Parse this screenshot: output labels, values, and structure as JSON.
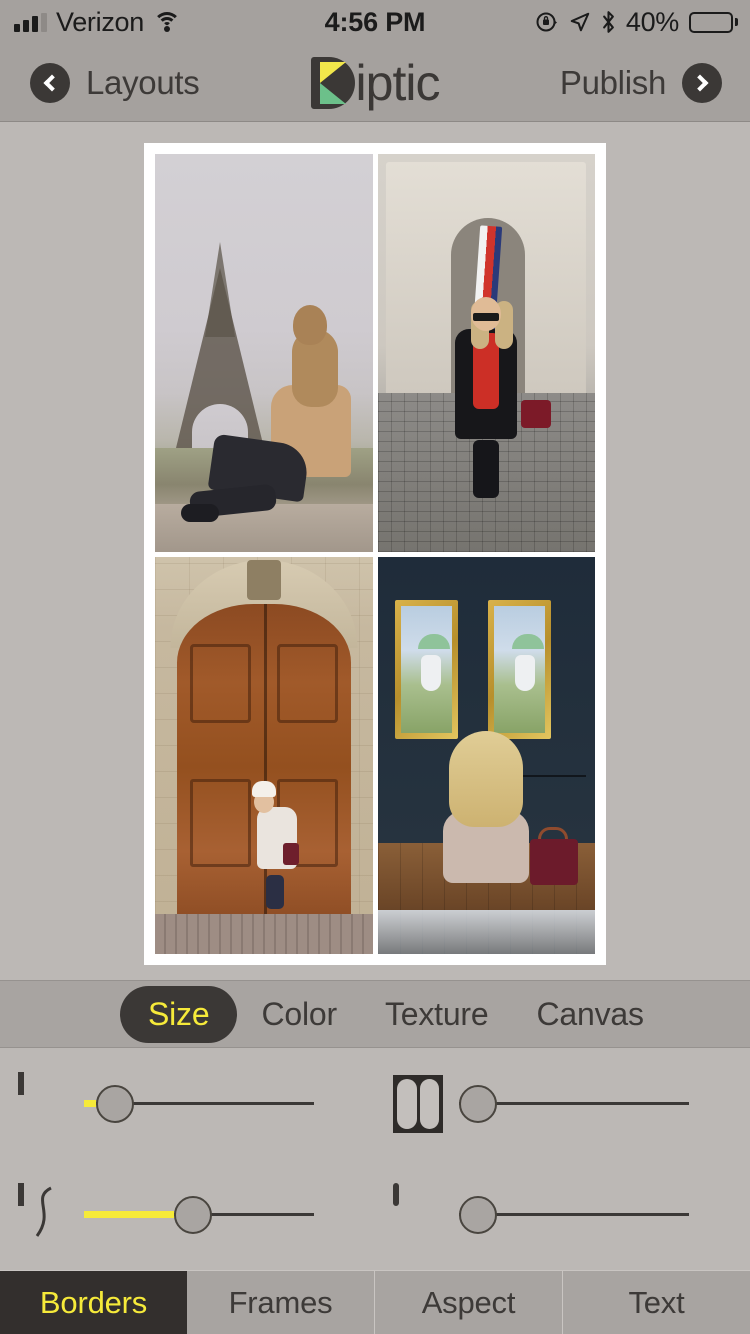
{
  "status_bar": {
    "carrier": "Verizon",
    "time": "4:56 PM",
    "battery_percent": "40%",
    "battery_level": 40,
    "icons": [
      "signal-icon",
      "wifi-icon",
      "rotation-lock-icon",
      "location-arrow-icon",
      "bluetooth-icon",
      "battery-icon"
    ]
  },
  "nav_bar": {
    "back_label": "Layouts",
    "app_title": "Diptic",
    "app_title_suffix": "iptic",
    "forward_label": "Publish",
    "logo_colors": {
      "dark": "#3b3836",
      "yellow": "#f2e74b",
      "green": "#6cc08a"
    }
  },
  "canvas": {
    "layout": "2x2-grid",
    "border_color": "#ffffff",
    "photos": [
      {
        "name": "eiffel-tower-photo",
        "caption": "Woman in tan sweater seated on ledge before the Eiffel Tower"
      },
      {
        "name": "arc-de-triomphe-photo",
        "caption": "Woman in black coat and red scarf at the Arc de Triomphe"
      },
      {
        "name": "wooden-doors-photo",
        "caption": "Woman in white fur coat and beanie before large wooden Parisian doors"
      },
      {
        "name": "museum-monet-photo",
        "caption": "Blonde woman seated viewing Monet paintings in a museum"
      }
    ]
  },
  "segments": {
    "items": [
      {
        "label": "Size",
        "active": true
      },
      {
        "label": "Color",
        "active": false
      },
      {
        "label": "Texture",
        "active": false
      },
      {
        "label": "Canvas",
        "active": false
      }
    ],
    "active_color": "#f6ea3a",
    "active_bg": "#3b3836"
  },
  "sliders": [
    {
      "name": "inner-border-width-slider",
      "icon": "inner-border-icon",
      "value": 6,
      "fill_color": "#f6ea3a"
    },
    {
      "name": "inner-corner-radius-slider",
      "icon": "rounded-cells-icon",
      "value": 0,
      "fill_color": "#f6ea3a"
    },
    {
      "name": "border-curve-slider",
      "icon": "s-curve-icon",
      "value": 47,
      "fill_color": "#f6ea3a"
    },
    {
      "name": "outer-corner-radius-slider",
      "icon": "rounded-outer-icon",
      "value": 0,
      "fill_color": "#f6ea3a"
    }
  ],
  "tab_bar": {
    "items": [
      {
        "label": "Borders",
        "active": true
      },
      {
        "label": "Frames",
        "active": false
      },
      {
        "label": "Aspect",
        "active": false
      },
      {
        "label": "Text",
        "active": false
      }
    ],
    "active_color": "#f6ea3a",
    "active_bg": "#332f2d"
  }
}
